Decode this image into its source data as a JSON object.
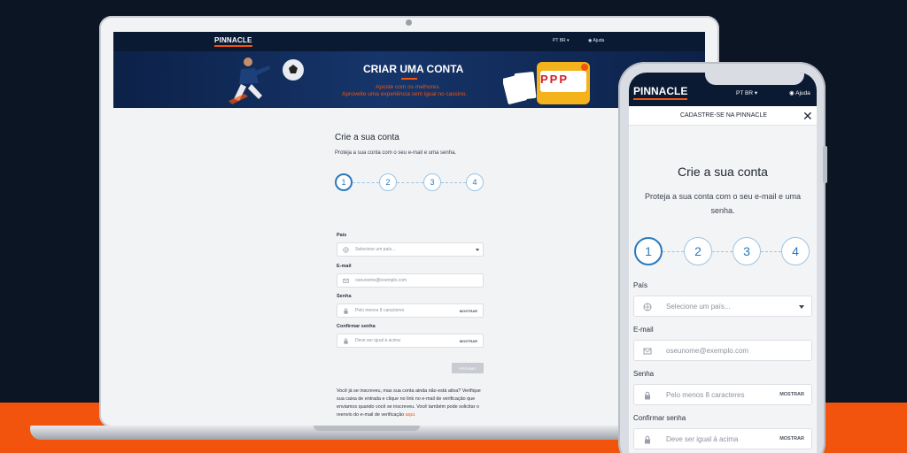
{
  "laptop": {
    "nav": {
      "logo": "PINNACLE",
      "lang": "PT BR ▾",
      "help": "Ajuda"
    },
    "banner": {
      "title": "CRIAR UMA CONTA",
      "subtitle1": "Aposte com os melhores.",
      "subtitle2": "Aproveite uma experiência sem igual no cassino.",
      "slot_text": "PPP"
    },
    "form": {
      "heading": "Crie a sua conta",
      "description": "Proteja a sua conta com o seu e-mail e uma senha.",
      "steps": [
        "1",
        "2",
        "3",
        "4"
      ],
      "country_label": "País",
      "country_placeholder": "Selecione um país...",
      "email_label": "E-mail",
      "email_placeholder": "oseunome@exemplo.com",
      "password_label": "Senha",
      "password_placeholder": "Pelo menos 8 caracteres",
      "password_action": "MOSTRAR",
      "confirm_label": "Confirmar senha",
      "confirm_placeholder": "Deve ser igual à acima",
      "confirm_action": "MOSTRAR",
      "next_button": "PRÓXIMO",
      "note": "Você já se inscreveu, mas sua conta ainda não está ativa? Verifique sua caixa de entrada e clique no link no e-mail de verificação que enviamos quando você se inscreveu. Você também pode solicitar o reenvio do e-mail de verificação ",
      "note_link": "aqui."
    }
  },
  "phone": {
    "nav": {
      "logo": "PINNACLE",
      "lang": "PT BR ▾",
      "help": "Ajuda"
    },
    "bar_title": "CADASTRE-SE NA PINNACLE",
    "close_symbol": "✕",
    "heading": "Crie a sua conta",
    "description": "Proteja a sua conta com o seu e-mail e uma senha.",
    "steps": [
      "1",
      "2",
      "3",
      "4"
    ],
    "country_label": "País",
    "country_placeholder": "Selecione um país...",
    "email_label": "E-mail",
    "email_placeholder": "oseunome@exemplo.com",
    "password_label": "Senha",
    "password_placeholder": "Pelo menos 8 caracteres",
    "password_action": "MOSTRAR",
    "confirm_label": "Confirmar senha",
    "confirm_placeholder": "Deve ser igual à acima",
    "confirm_action": "MOSTRAR"
  },
  "colors": {
    "background": "#0b1524",
    "accent_orange": "#f2530d",
    "navy": "#0b1a33",
    "step_blue": "#2a79bd"
  }
}
